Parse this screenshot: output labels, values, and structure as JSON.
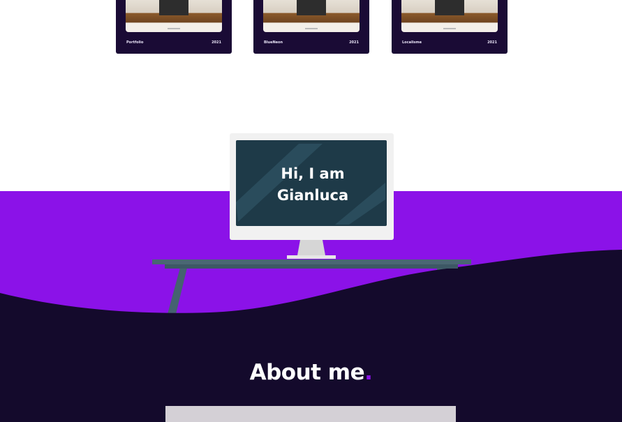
{
  "projects": [
    {
      "name": "Portfolio",
      "year": "2021"
    },
    {
      "name": "BlueNeon",
      "year": "2021"
    },
    {
      "name": "Localisme",
      "year": "2021"
    }
  ],
  "hero": {
    "greeting_line1": "Hi, I am",
    "greeting_line2": "Gianluca"
  },
  "about": {
    "title": "About me",
    "title_dot": "."
  },
  "colors": {
    "purple": "#8b12e8",
    "dark": "#140a2c",
    "screen": "#1e3a48",
    "desk": "#456270"
  }
}
